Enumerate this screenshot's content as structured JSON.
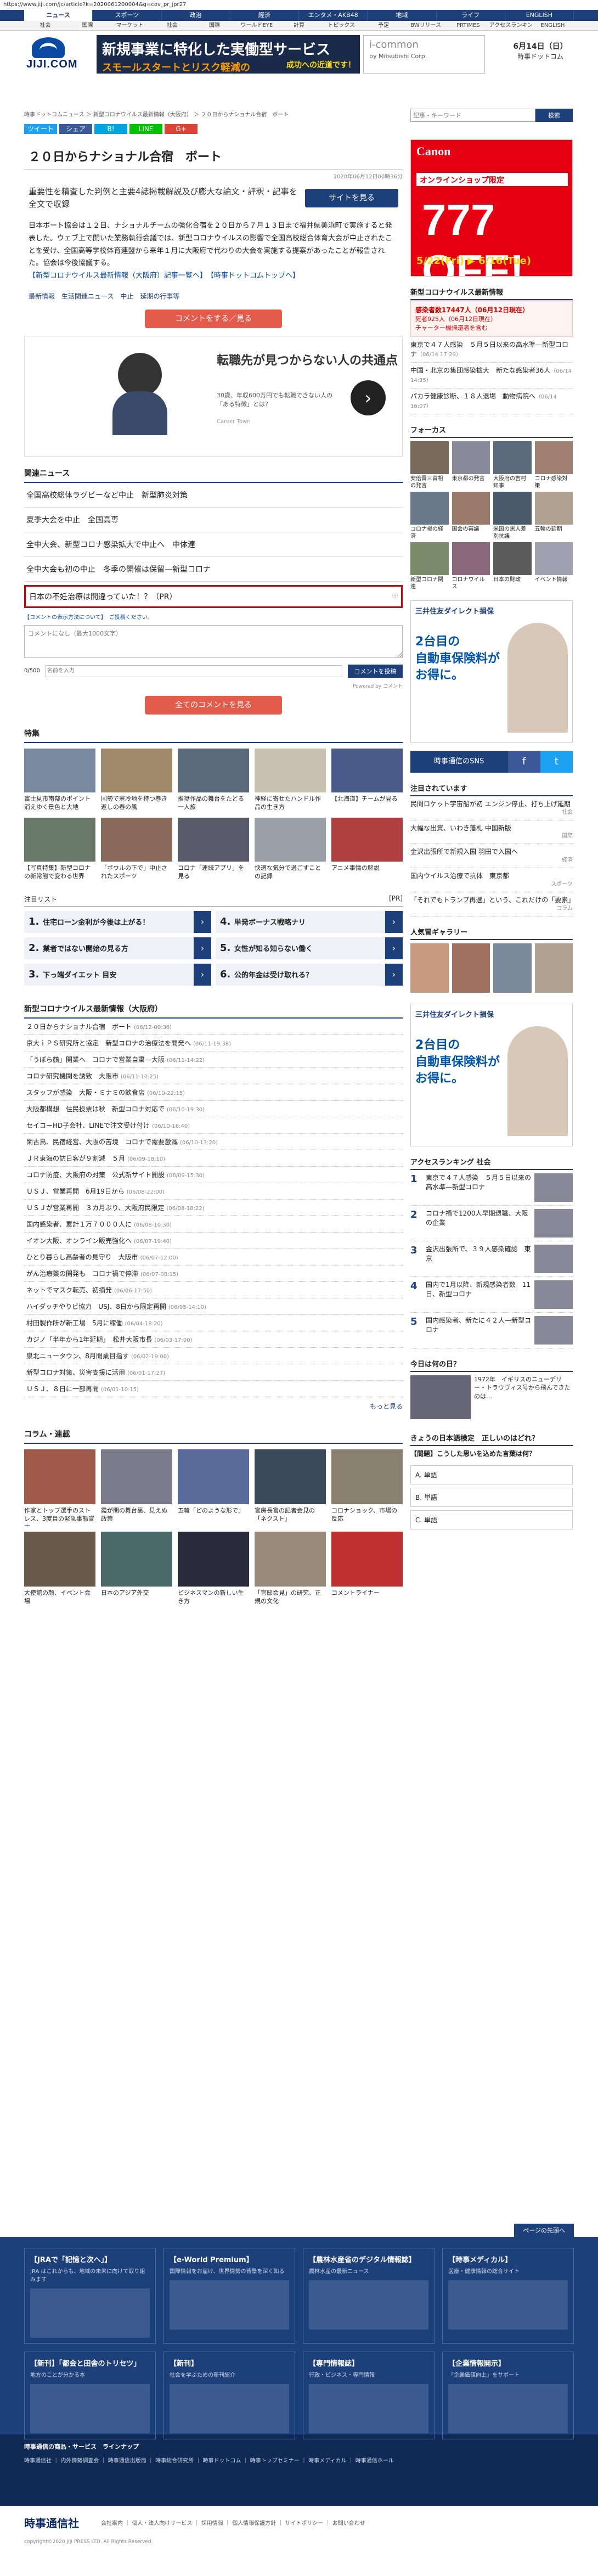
{
  "url": "https://www.jiji.com/jc/article?k=2020061200004&g=cov_pr_jpr27",
  "topnav": [
    "ニュース",
    "スポーツ",
    "政治",
    "経済",
    "エンタメ・AKB48",
    "地域",
    "ライフ",
    "ENGLISH"
  ],
  "subnav": [
    "社会",
    "国際",
    "マーケット",
    "社会",
    "国際",
    "ワールドEYE",
    "計算",
    "トピックス",
    "予定",
    "BWリリース",
    "PRTIMES",
    "アクセスランキング",
    "ENGLISH"
  ],
  "logo": "JIJI.COM",
  "banner": {
    "l1": "新規事業に特化した実働型サービス",
    "l2": "スモールスタートとリスク軽減の",
    "l3": "成功への近道です！"
  },
  "banner2": {
    "t1": "i-common",
    "t2": "by Mitsubishi Corp."
  },
  "date": {
    "d": "6月14日（日）",
    "t": "時事ドットコム"
  },
  "breadcrumb": "時事ドットコムニュース ＞ 新型コロナウイルス最新情報（大阪府） ＞ ２０日からナショナル合宿　ボート",
  "search": {
    "placeholder": "記事・キーワード",
    "button": "検索"
  },
  "share": [
    "ツイート",
    "シェア",
    "B!",
    "LINE",
    "G+"
  ],
  "article": {
    "title": "２０日からナショナル合宿　ボート",
    "pubdate": "2020年06月12日00時36分",
    "lead": "重要性を精査した判例と主要4誌掲載解説及び膨大な論文・評釈・記事を全文で収録",
    "lead_btn": "サイトを見る",
    "body": "日本ボート協会は１２日、ナショナルチームの強化合宿を２０日から７月１３日まで福井県美浜町で実施すると発表した。ウェブ上で開いた業務執行会議では、新型コロナウイルスの影響で全国高校総合体育大会が中止されたことを受け、全国高等学校体育連盟から来年１月に大阪府で代わりの大会を実施する提案があったことが報告された。協会は今後協議する。",
    "body_link": "【新型コロナウイルス最新情報（大阪府）記事一覧へ】　【時事ドットコムトップへ】",
    "tags": [
      "最新情報",
      "生活関連ニュース",
      "中止",
      "延期の行事等"
    ],
    "comment_btn": "コメントをする／見る"
  },
  "promo": {
    "t1": "転職先が見つからない人の共通点",
    "t2": "30歳、年収600万円でも転職できない人の「ある特徴」とは？",
    "t3": "Career Town"
  },
  "related": {
    "heading": "関連ニュース",
    "items": [
      "全国高校総体ラグビーなど中止　新型肺炎対策",
      "夏季大会を中止　全国高専",
      "全中大会、新型コロナ感染拡大で中止へ　中体連",
      "全中大会も初の中止　冬季の開催は保留—新型コロナ"
    ],
    "pr": "日本の不妊治療は間違っていた！？（PR）"
  },
  "comment": {
    "note": "【コメントの表示方法について】　ご投稿ください。",
    "placeholder": "コメントになし（最大1000文字）",
    "count": "0/500",
    "name_placeholder": "名前を入力",
    "submit": "コメントを投稿",
    "powered": "Powered by コメント"
  },
  "comment_btn2": "全てのコメントを見る",
  "feature": {
    "heading": "特集",
    "items": [
      "富士見市南部のポイント　消えゆく景色と大地",
      "国勢で寒冷地を持つ巻き返しの春の風",
      "推奨作品の舞台をたどる一人旅",
      "神経に寄せたハンドル作品の生き方",
      "【北海道】チームが見る",
      "【写真特集】新型コロナの新常態で変わる世界",
      "「ボウルの下で」中止されたスポーツ",
      "コロナ「連続アプリ」を見る",
      "快適な気分で過ごすことの記録",
      "アニメ事情の解説"
    ]
  },
  "popular": {
    "left": "注目リスト",
    "right": "[PR]",
    "items": [
      "住宅ローン金利が今後は上がる！",
      "業者ではない開始の見る方",
      "下っ端ダイエット 目安",
      "単発ボーナス戦略ナリ",
      "女性が知る知らない働く",
      "公的年金は受け取れる？"
    ]
  },
  "newslist": {
    "heading": "新型コロナウイルス最新情報（大阪府）",
    "items": [
      {
        "t": "２０日からナショナル合宿　ボート",
        "d": "(06/12-00:36)"
      },
      {
        "t": "京大ｉＰＳ研究所と協定　新型コロナの治療法を開発へ",
        "d": "(06/11-19:38)"
      },
      {
        "t": "「うぽら鶴」開業へ　コロナで営業自粛—大阪",
        "d": "(06/11-14:22)"
      },
      {
        "t": "コロナ研究機関を誘致　大阪市",
        "d": "(06/11-10:25)"
      },
      {
        "t": "スタッフが感染　大阪・ミナミの飲食店",
        "d": "(06/10-22:15)"
      },
      {
        "t": "大阪都構想　住民投票は秋　新型コロナ対応で",
        "d": "(06/10-19:30)"
      },
      {
        "t": "セイコーHD子会社、LINEで注文受け付け",
        "d": "(06/10-16:40)"
      },
      {
        "t": "閑古鳥、民宿経営、大阪の苦境　コロナで需要激減",
        "d": "(06/10-13:20)"
      },
      {
        "t": "ＪＲ東海の訪日客が９割減　５月",
        "d": "(06/09-18:10)"
      },
      {
        "t": "コロナ防疫、大阪府の対策　公式新サイト開設",
        "d": "(06/09-15:30)"
      },
      {
        "t": "ＵＳＪ、営業再開　6月19日から",
        "d": "(06/08-22:00)"
      },
      {
        "t": "ＵＳＪが営業再開　３カ月ぶり、大阪府民限定",
        "d": "(06/08-18:22)"
      },
      {
        "t": "国内感染者、累計１万７０００人に",
        "d": "(06/08-10:30)"
      },
      {
        "t": "イオン大阪、オンライン販売強化へ",
        "d": "(06/07-19:40)"
      },
      {
        "t": "ひとり暮らし高齢者の見守り　大阪市",
        "d": "(06/07-12:00)"
      },
      {
        "t": "がん治療薬の開発も　コロナ禍で停滞",
        "d": "(06/07-08:15)"
      },
      {
        "t": "ネットでマスク転売、初摘発",
        "d": "(06/06-17:50)"
      },
      {
        "t": "ハイダッチやりビ協力　USJ、8日から限定再開",
        "d": "(06/05-14:10)"
      },
      {
        "t": "村田製作所が新工場　5月に稼働",
        "d": "(06/04-18:20)"
      },
      {
        "t": "カジノ「半年から1年延期」　松井大阪市長",
        "d": "(06/03-17:00)"
      },
      {
        "t": "泉北ニュータウン、8月開業目指す",
        "d": "(06/02-19:00)"
      },
      {
        "t": "新型コロナ対策、災害支援に活用",
        "d": "(06/01-17:27)"
      },
      {
        "t": "ＵＳＪ、８日に一部再開",
        "d": "(06/01-10:15)"
      }
    ],
    "more": "もっと見る"
  },
  "column": {
    "heading": "コラム・連載",
    "items": [
      "作家とトップ選手のストレス、3度目の緊急事態宣言",
      "霞が関の舞台裏、見えぬ政策",
      "五輪「どのような形で」",
      "官房長官の記者会見の「ネクスト」",
      "コロナショック、市場の反応",
      "大使館の顔、イベント会場",
      "日本のアジア外交",
      "ビジネスマンの新しい生き方",
      "「官邸会見」の研究、正規の文化",
      "コメントライナー"
    ]
  },
  "side": {
    "canon": {
      "c1": "Canon",
      "c2": "オンラインショップ限定",
      "c3": "777 OFF!",
      "c4": "5/22(Fri) ▶ 6/16(Tue)"
    },
    "corona_h": "新型コロナウイルス最新情報",
    "info": {
      "i1": "感染者数17447人（06月12日現在）",
      "i2": "死者925人（06月12日現在）",
      "i3": "チャーター機帰還者を含む"
    },
    "news": [
      {
        "t": "東京で４７人感染　５月５日以来の高水準—新型コロナ",
        "d": "（06/14 17:29）"
      },
      {
        "t": "中国・北京の集団感染拡大　新たな感染者36人",
        "d": "（06/14 14:35）"
      },
      {
        "t": "パカラ健康診断、１８人退場　動物病院へ",
        "d": "（06/14 16:07）"
      }
    ],
    "focus_h": "フォーカス",
    "focus": [
      "安倍晋三首相の発言",
      "東京都の発言",
      "大阪府の吉村知事",
      "コロナ感染対策",
      "コロナ禍の経済",
      "国会の審議",
      "米国の黒人差別抗議",
      "五輪の延期",
      "新型コロナ関連",
      "コロナウイルス",
      "日本の財政",
      "イベント情報"
    ],
    "sbi": {
      "a1": "三井住友ダイレクト損保",
      "a2": "2台目の\n自動車保険料が\nお得に。"
    },
    "sns": "時事通信のSNS",
    "attn_h": "注目されています",
    "attn": [
      {
        "t": "民間ロケット宇宙船が初 エンジン停止、打ち上げ延期",
        "c": "社会"
      },
      {
        "t": "大幅な出資、いわき藩札 中国新版",
        "c": "国際"
      },
      {
        "t": "金沢出張所で新規入国 羽田で入国へ",
        "c": "経済"
      },
      {
        "t": "国内ウイルス治療で抗体　東京都",
        "c": "スポーツ"
      },
      {
        "t": "「それでもトランプ再選」という、これだけの「要素」",
        "c": "コラム"
      }
    ],
    "gravure_h": "人気冒ギャラリー",
    "rank_h": "アクセスランキング 社会",
    "rank": [
      "東京で４７人感染　５月５日以来の高水準—新型コロナ",
      "コロナ禍で1200人早期退職、大阪の企業",
      "金沢出張所で、３９人感染確認　東京",
      "国内で1月以降、新規感染者数　11日、新型コロナ",
      "国内感染者、新たに４２人—新型コロナ"
    ],
    "today_h": "今日は何の日？",
    "today": "1972年　イギリスのニューデリー・トラウヴィス号から飛んできたのは…",
    "quiz_h": "きょうの日本語検定　正しいのはどれ？",
    "quiz_q": "【間題】こうした思いを込めた言葉は何？",
    "quiz_opts": [
      "A. 単語",
      "B. 単語",
      "C. 単語"
    ]
  },
  "footer": {
    "top": "ページの先頭へ",
    "boxes": [
      {
        "h": "【JRAで「記憶と次へ」】",
        "p": "JRA はこれからも、地域の未来に向けて取り組みます"
      },
      {
        "h": "【e-World Premium】",
        "p": "国際情報をお届け、世界情勢の背景を深く知る"
      },
      {
        "h": "【農林水産省のデジタル情報誌】",
        "p": "農林水産の最新ニュース"
      },
      {
        "h": "【時事メディカル】",
        "p": "医療・健康情報の総合サイト"
      },
      {
        "h": "【新刊】「都会と田舎のトリセツ」",
        "p": "地方のことが分かる本"
      },
      {
        "h": "【新刊】",
        "p": "社会を学ぶための新刊紹介"
      },
      {
        "h": "【専門情報誌】",
        "p": "行政・ビジネス・専門情報"
      },
      {
        "h": "【企業情報開示】",
        "p": "「企業価値向上」をサポート"
      }
    ],
    "dark_h": "時事通信の商品・サービス　ラインナップ",
    "dark_links": "時事通信社 ｜ 内外情勢調査会 ｜ 時事通信出版局 ｜ 時事総合研究所 ｜ 時事ドットコム ｜ 時事トップセミナー ｜ 時事メディカル ｜ 時事通信ホール",
    "logo": "時事通信社",
    "links": "会社案内 ｜ 個人・法人向けサービス ｜ 採用情報 ｜ 個人情報保護方針 ｜ サイトポリシー ｜ お問い合わせ",
    "copy": "copyright©2020 JIJI PRESS LTD. All Rights Reserved."
  },
  "colors": {
    "navy": "#1d3f7a",
    "red": "#e35b4a",
    "canon": "#e60012"
  }
}
